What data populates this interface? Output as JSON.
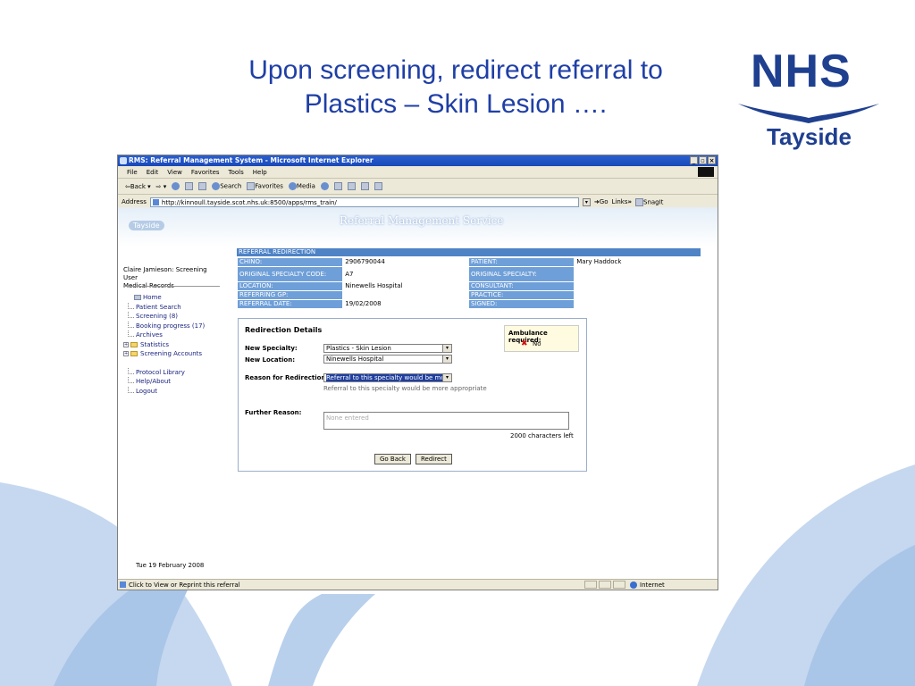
{
  "slide": {
    "title_line1": "Upon screening, redirect referral to",
    "title_line2": "Plastics – Skin Lesion ….",
    "logo_main": "NHS",
    "logo_sub": "Tayside"
  },
  "browser": {
    "title": "RMS: Referral Management System - Microsoft Internet Explorer",
    "menu": [
      "File",
      "Edit",
      "View",
      "Favorites",
      "Tools",
      "Help"
    ],
    "toolbar": {
      "back": "Back",
      "search": "Search",
      "favorites": "Favorites",
      "media": "Media"
    },
    "address_label": "Address",
    "url": "http://kinnoull.tayside.scot.nhs.uk:8500/apps/rms_train/",
    "go": "Go",
    "links": "Links",
    "links_more": "»",
    "snagit": "SnagIt",
    "status_text": "Click to View or Reprint this referral",
    "zone": "Internet"
  },
  "app": {
    "banner_logo": "Tayside",
    "banner_title": "Referral Management Service",
    "user_line1": "Claire Jamieson: Screening User",
    "user_line2": "Medical Records",
    "nav": {
      "home": "Home",
      "patient_search": "Patient Search",
      "screening": "Screening (8)",
      "booking": "Booking progress (17)",
      "archives": "Archives",
      "statistics": "Statistics",
      "screening_accounts": "Screening Accounts",
      "protocol": "Protocol Library",
      "help": "Help/About",
      "logout": "Logout"
    },
    "date": "Tue 19 February 2008"
  },
  "referral": {
    "header": "REFERRAL REDIRECTION",
    "rows": [
      {
        "l1": "CHINO:",
        "v1": "2906790044",
        "l2": "PATIENT:",
        "v2": "Mary Haddock"
      },
      {
        "l1": "ORIGINAL SPECIALTY CODE:",
        "v1": "A7",
        "l2": "ORIGINAL SPECIALTY:",
        "v2": ""
      },
      {
        "l1": "LOCATION:",
        "v1": "Ninewells Hospital",
        "l2": "CONSULTANT:",
        "v2": ""
      },
      {
        "l1": "REFERRING GP:",
        "v1": "",
        "l2": "PRACTICE:",
        "v2": ""
      },
      {
        "l1": "REFERRAL DATE:",
        "v1": "19/02/2008",
        "l2": "SIGNED:",
        "v2": ""
      }
    ]
  },
  "redirection": {
    "heading": "Redirection Details",
    "ambulance_label": "Ambulance required:",
    "ambulance_value": "No",
    "new_specialty_label": "New Specialty:",
    "new_specialty_value": "Plastics - Skin Lesion",
    "new_location_label": "New Location:",
    "new_location_value": "Ninewells Hospital",
    "reason_label": "Reason for Redirection:",
    "reason_value": "Referral to this specialty would be more",
    "reason_help": "Referral to this specialty would be more appropriate",
    "further_label": "Further Reason:",
    "further_placeholder": "None entered",
    "chars_left": "2000 characters left",
    "go_back": "Go Back",
    "redirect": "Redirect"
  }
}
